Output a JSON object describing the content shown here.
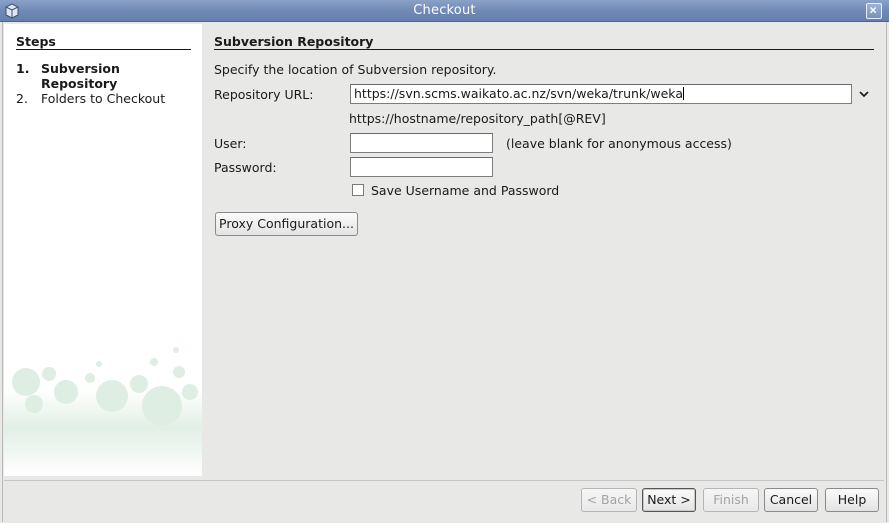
{
  "window": {
    "title": "Checkout",
    "icon": "netbeans-cube-icon",
    "close_icon": "close-icon",
    "title_bar_color": "#6f88b4"
  },
  "steps": {
    "heading": "Steps",
    "items": [
      {
        "number": "1.",
        "label": "Subversion Repository",
        "active": true
      },
      {
        "number": "2.",
        "label": "Folders to Checkout",
        "active": false
      }
    ]
  },
  "main": {
    "heading": "Subversion Repository",
    "instruction": "Specify the location of Subversion repository.",
    "url_label": "Repository URL:",
    "url_value": "https://svn.scms.waikato.ac.nz/svn/weka/trunk/weka",
    "url_hint": "https://hostname/repository_path[@REV]",
    "user_label": "User:",
    "user_value": "",
    "user_hint": "(leave blank for anonymous access)",
    "password_label": "Password:",
    "password_value": "",
    "save_checkbox_label": "Save Username and Password",
    "save_checked": false,
    "proxy_button": "Proxy Configuration..."
  },
  "footer": {
    "back": "< Back",
    "next": "Next >",
    "finish": "Finish",
    "cancel": "Cancel",
    "help": "Help"
  }
}
